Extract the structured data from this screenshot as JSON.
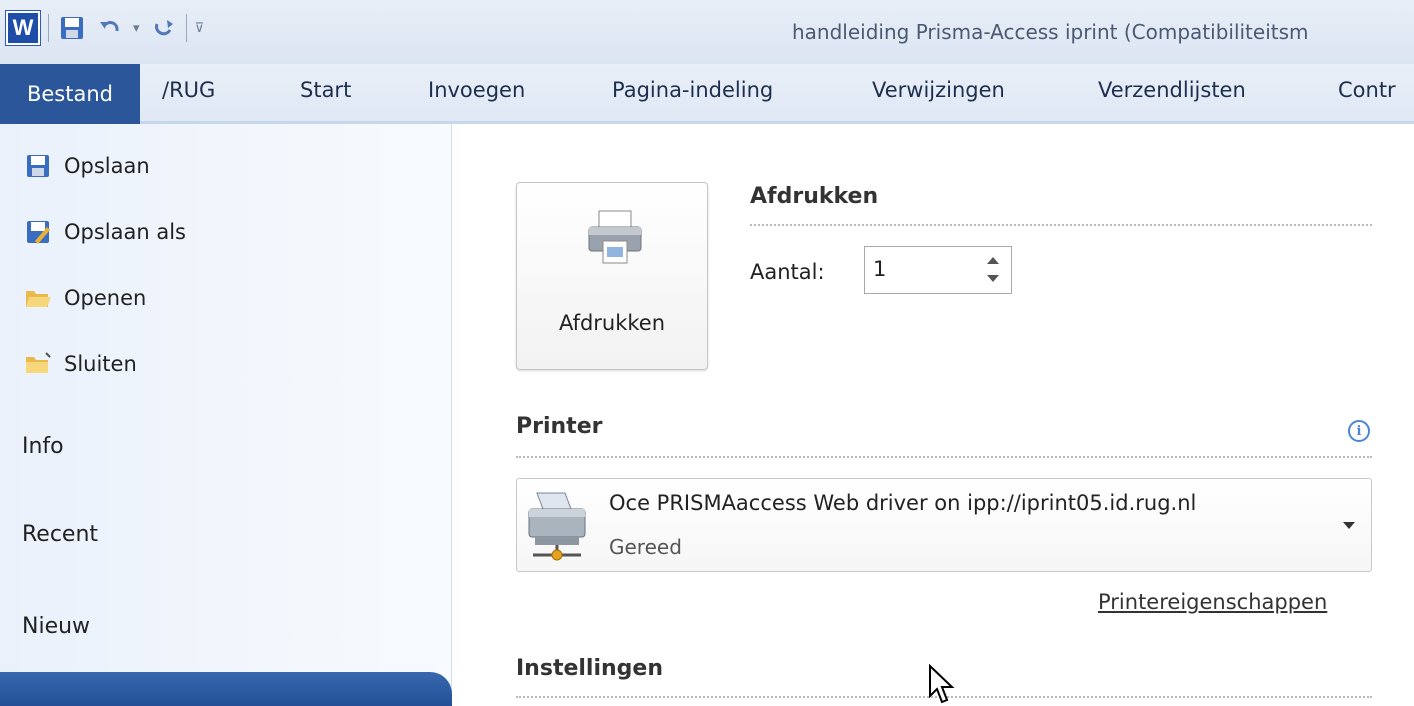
{
  "window": {
    "title": "handleiding Prisma-Access iprint (Compatibiliteitsm",
    "app_icon_letter": "W"
  },
  "quick_access": {
    "icons": [
      "save-icon",
      "undo-icon",
      "undo-dropdown-icon",
      "redo-icon",
      "customize-dropdown-icon"
    ]
  },
  "ribbon": {
    "tabs": [
      {
        "label": "Bestand",
        "active": true
      },
      {
        "label": "/RUG"
      },
      {
        "label": "Start"
      },
      {
        "label": "Invoegen"
      },
      {
        "label": "Pagina-indeling"
      },
      {
        "label": "Verwijzingen"
      },
      {
        "label": "Verzendlijsten"
      },
      {
        "label": "Contr"
      }
    ],
    "active_color": "#2b579a"
  },
  "backstage_nav": {
    "commands": [
      {
        "label": "Opslaan",
        "icon": "save-icon"
      },
      {
        "label": "Opslaan als",
        "icon": "save-as-icon"
      },
      {
        "label": "Openen",
        "icon": "open-folder-icon"
      },
      {
        "label": "Sluiten",
        "icon": "close-folder-icon"
      }
    ],
    "tabs": [
      {
        "label": "Info"
      },
      {
        "label": "Recent"
      },
      {
        "label": "Nieuw"
      }
    ]
  },
  "print": {
    "section_title": "Afdrukken",
    "button_label": "Afdrukken",
    "copies_label": "Aantal:",
    "copies_value": "1"
  },
  "printer": {
    "section_title": "Printer",
    "name": "Oce PRISMAaccess Web driver on ipp://iprint05.id.rug.nl",
    "status": "Gereed",
    "properties_link": "Printereigenschappen",
    "info_icon": "i"
  },
  "settings": {
    "section_title": "Instellingen"
  }
}
